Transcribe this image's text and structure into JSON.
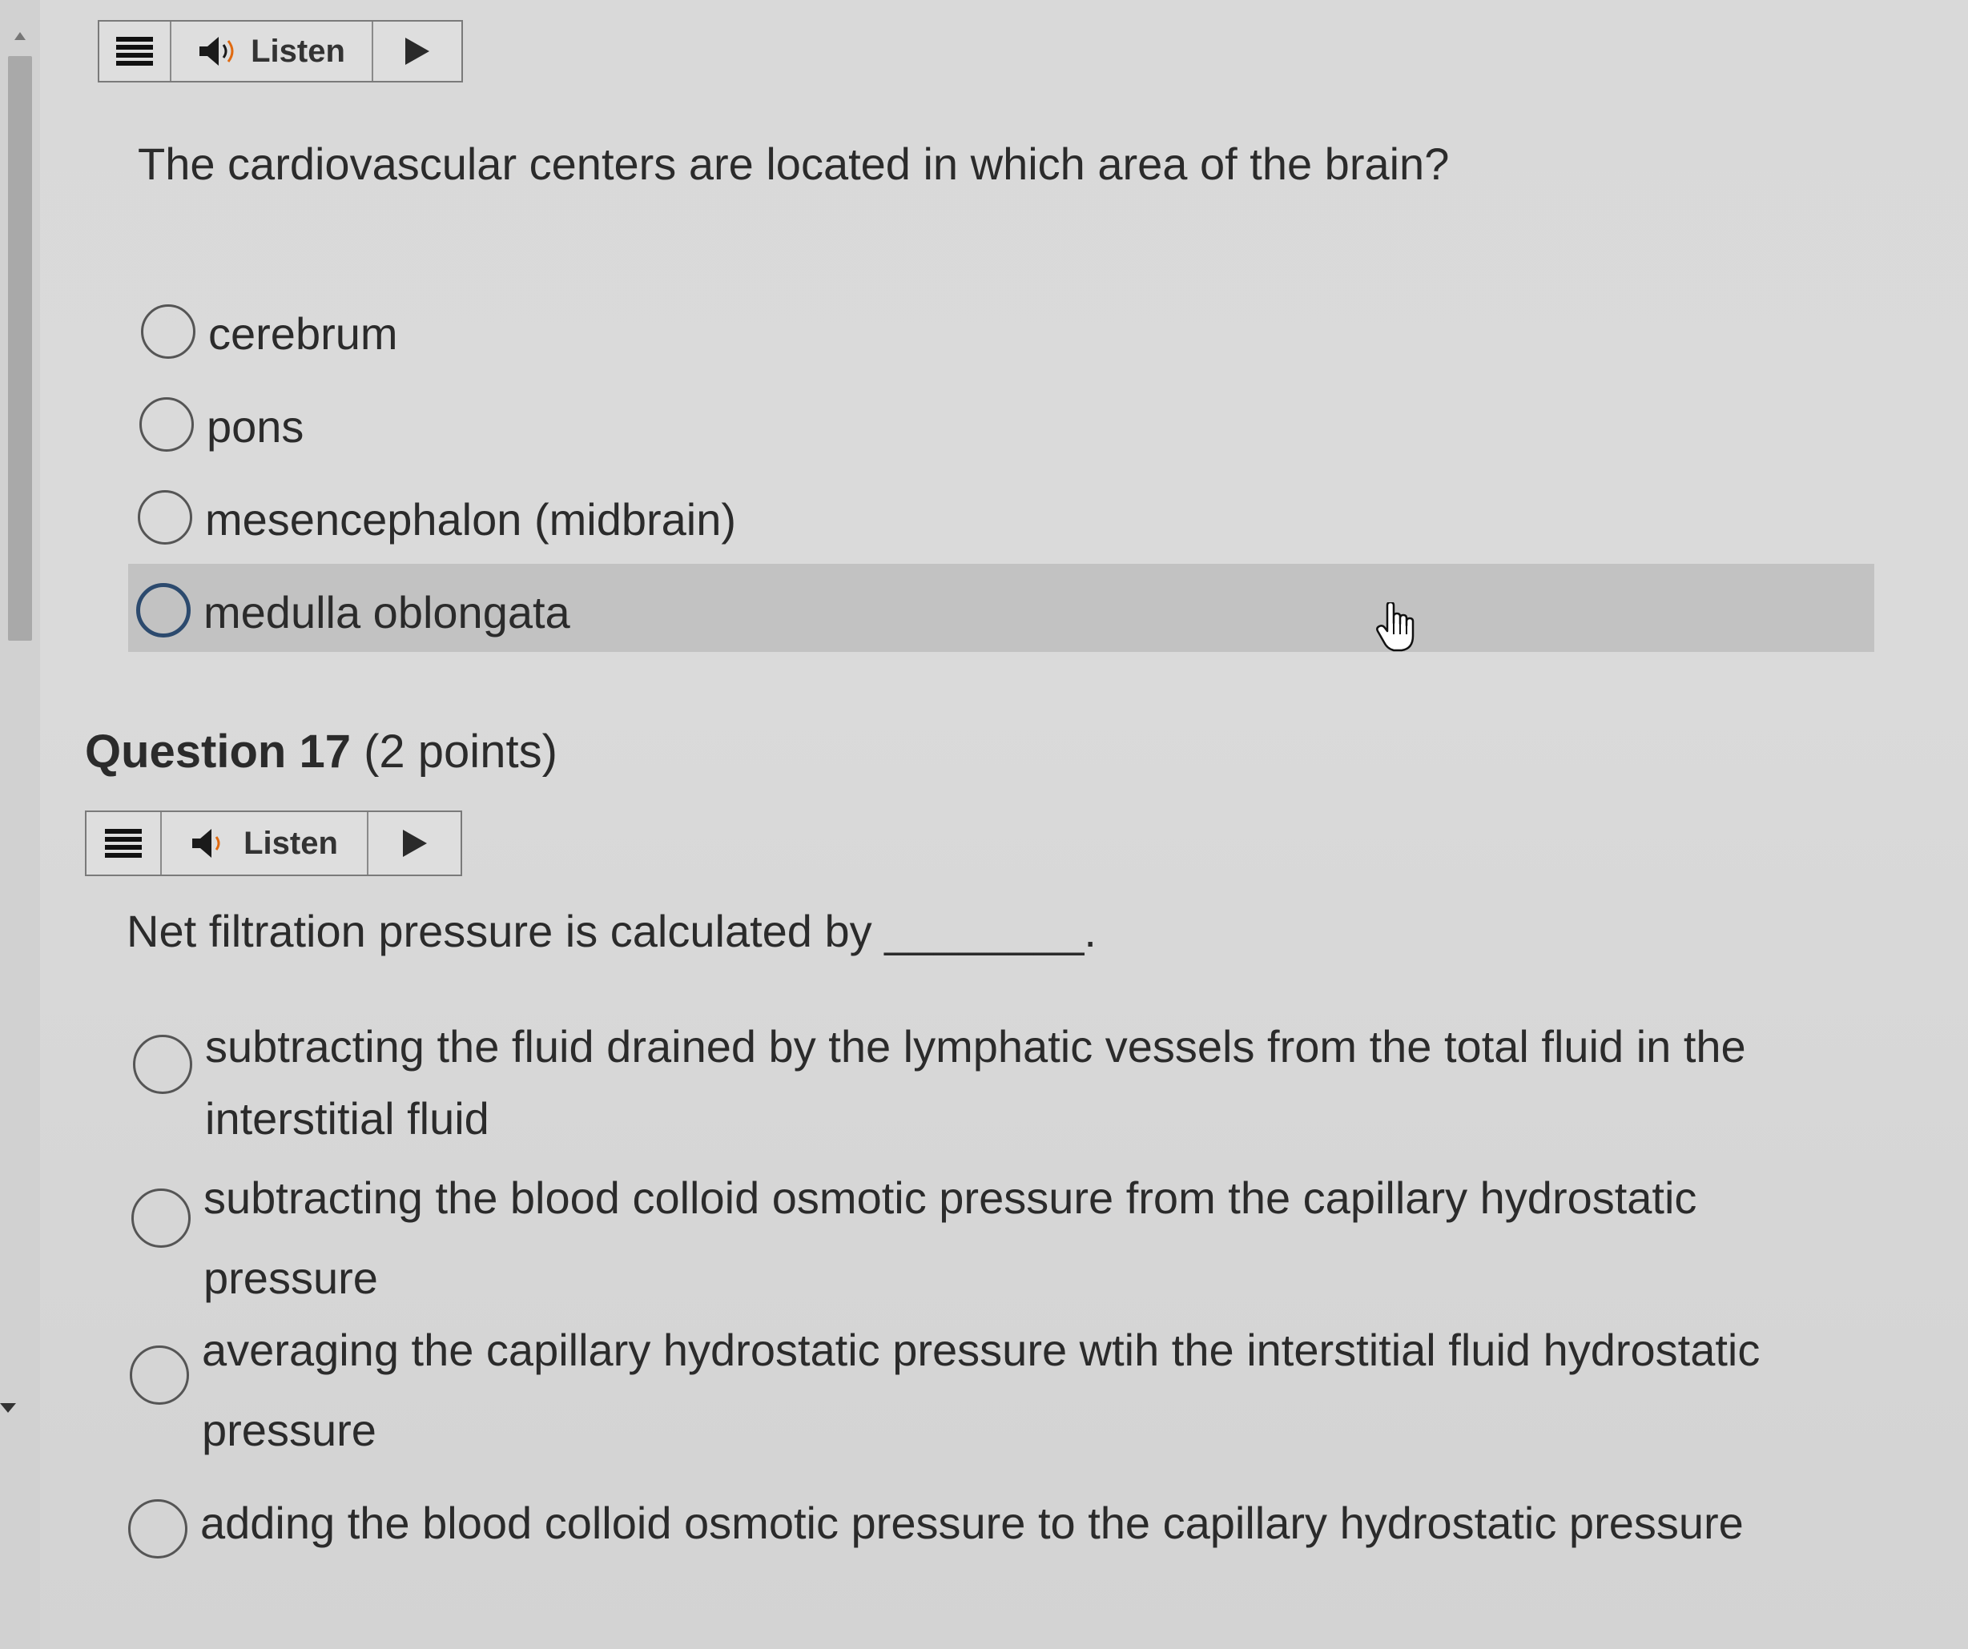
{
  "listen_bar_1": {
    "menu_icon": "menu-icon",
    "speaker_icon": "speaker-icon",
    "listen_label": "Listen",
    "play_icon": "play-icon"
  },
  "question_16": {
    "text": "The cardiovascular centers are located in which area of the brain?",
    "options": [
      {
        "label": "cerebrum"
      },
      {
        "label": "pons"
      },
      {
        "label": "mesencephalon (midbrain)"
      },
      {
        "label": "medulla oblongata"
      }
    ]
  },
  "question_17": {
    "title": "Question 17",
    "points": "(2 points)",
    "listen_label": "Listen",
    "text": "Net filtration pressure is calculated by ________.",
    "options": [
      {
        "line1": "subtracting the fluid drained by the lymphatic vessels from the total fluid in the",
        "line2": "interstitial fluid"
      },
      {
        "line1": "subtracting the blood colloid osmotic pressure from the capillary hydrostatic",
        "line2": "pressure"
      },
      {
        "line1": "averaging the capillary hydrostatic pressure wtih the interstitial fluid hydrostatic",
        "line2": "pressure"
      },
      {
        "line1": "adding the blood colloid osmotic pressure to the capillary hydrostatic pressure",
        "line2": ""
      }
    ]
  },
  "cursor_icon": "hand-pointer-icon",
  "colors": {
    "background": "#d9d9d9",
    "highlight": "#c2c2c2",
    "focus_ring": "#2c4a6e",
    "text": "#2b2b2b"
  }
}
